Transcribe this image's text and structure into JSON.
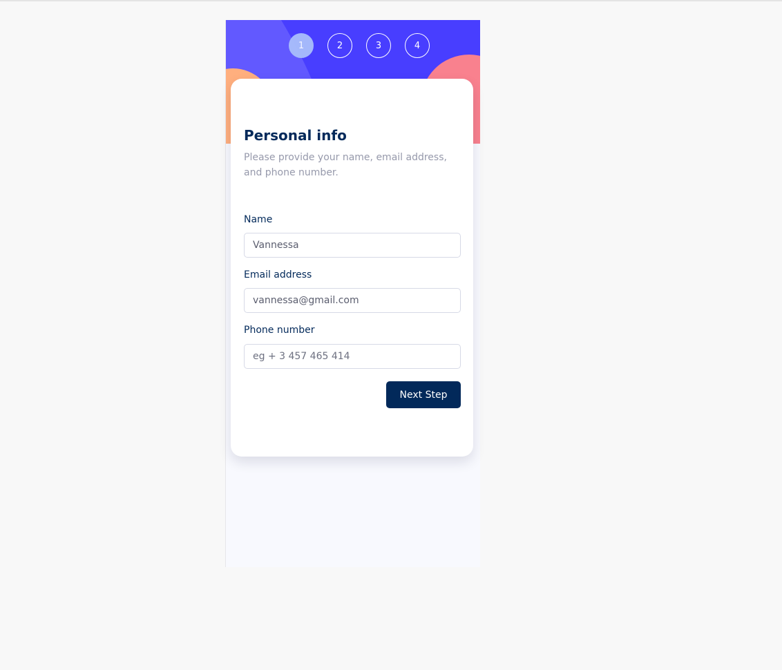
{
  "steps": [
    {
      "number": "1",
      "active": true
    },
    {
      "number": "2",
      "active": false
    },
    {
      "number": "3",
      "active": false
    },
    {
      "number": "4",
      "active": false
    }
  ],
  "form": {
    "title": "Personal info",
    "description": "Please provide your name, email address, and phone number.",
    "fields": [
      {
        "label": "Name",
        "value": "Vannessa",
        "placeholder": ""
      },
      {
        "label": "Email address",
        "value": "vannessa@gmail.com",
        "placeholder": ""
      },
      {
        "label": "Phone number",
        "value": "",
        "placeholder": "eg + 3 457 465 414"
      }
    ],
    "next_label": "Next Step"
  },
  "colors": {
    "header_bg": "#483eff",
    "accent_orange": "#ffaf7e",
    "accent_pink": "#f9818e",
    "title": "#02295a",
    "button_bg": "#02295a",
    "active_step": "#a9bffb"
  }
}
